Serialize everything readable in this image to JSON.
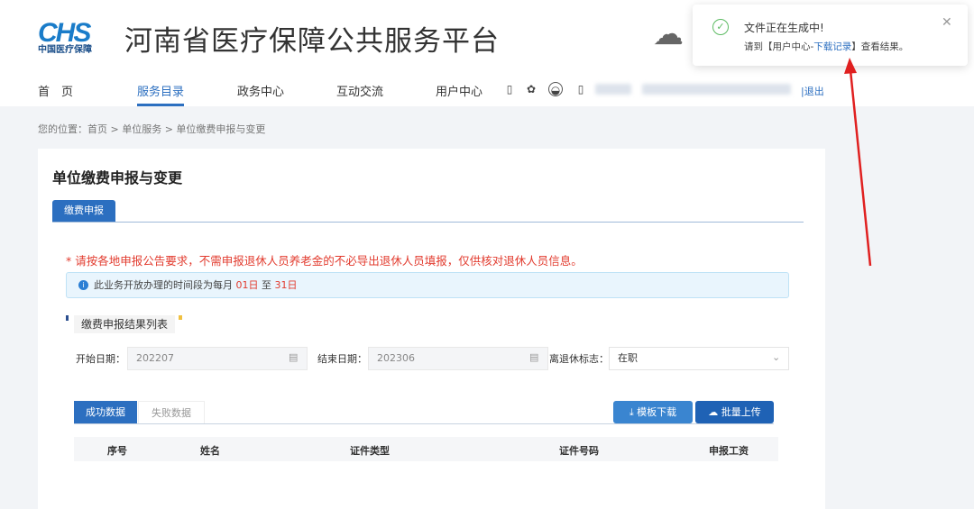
{
  "header": {
    "logo_mark": "CHS",
    "logo_sub": "中国医疗保障",
    "title": "河南省医疗保障公共服务平台",
    "logout": "|退出"
  },
  "nav": [
    {
      "label": "首　页"
    },
    {
      "label": "服务目录",
      "active": true
    },
    {
      "label": "政务中心"
    },
    {
      "label": "互动交流"
    },
    {
      "label": "用户中心"
    }
  ],
  "breadcrumb": "您的位置：首页  >  单位服务  >  单位缴费申报与变更",
  "page": {
    "title": "单位缴费申报与变更",
    "tab": "缴费申报",
    "note": "* 请按各地申报公告要求，不需申报退休人员养老金的不必导出退休人员填报，仅供核对退休人员信息。",
    "info_prefix": "此业务开放办理的时间段为每月 ",
    "info_start": "01日",
    "info_mid": " 至 ",
    "info_end": "31日",
    "section": "缴费申报结果列表"
  },
  "filters": {
    "start_label": "开始日期：",
    "start_value": "202207",
    "end_label": "结束日期：",
    "end_value": "202306",
    "retire_label": "离退休标志：",
    "retire_value": "在职"
  },
  "data_tabs": [
    "成功数据",
    "失败数据"
  ],
  "buttons": {
    "download": "模板下载",
    "upload": "批量上传"
  },
  "table": {
    "columns": [
      "序号",
      "姓名",
      "证件类型",
      "证件号码",
      "申报工资"
    ]
  },
  "toast": {
    "title": "文件正在生成中!",
    "msg_prefix": "请到【用户中心-",
    "msg_link": "下载记录",
    "msg_suffix": "】查看结果。"
  },
  "colors": {
    "primary": "#2c6fc0",
    "danger": "#e23b2e",
    "success": "#5dbb63"
  }
}
